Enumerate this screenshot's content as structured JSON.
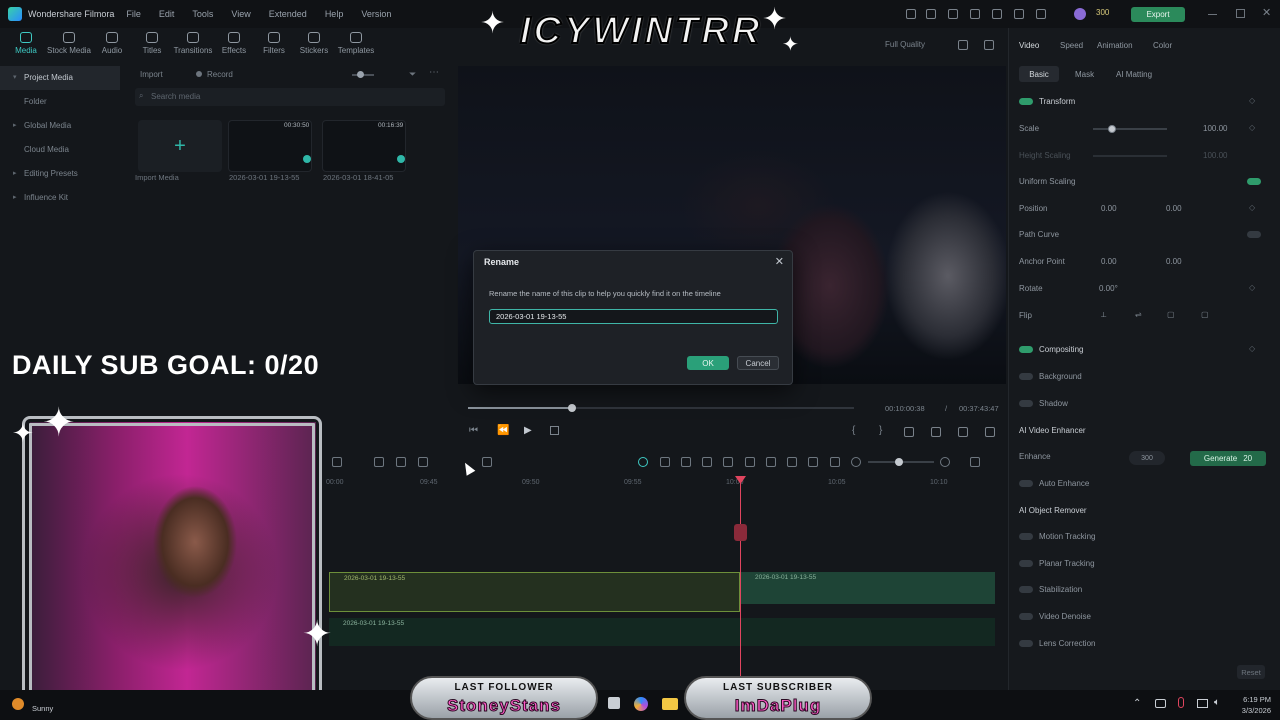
{
  "app": {
    "title": "Wondershare Filmora",
    "menu": [
      "File",
      "Edit",
      "Tools",
      "View",
      "Extended",
      "Help",
      "Version"
    ],
    "credits": "300",
    "export_label": "Export"
  },
  "media_tabs": [
    "Media",
    "Stock Media",
    "Audio",
    "Titles",
    "Transitions",
    "Effects",
    "Filters",
    "Stickers",
    "Templates"
  ],
  "sidebar": {
    "items": [
      "Project Media",
      "Folder",
      "Global Media",
      "Cloud Media",
      "Editing Presets",
      "Influence Kit"
    ]
  },
  "media": {
    "import_label": "Import",
    "record_label": "Record",
    "search_placeholder": "Search media",
    "import_media_label": "Import Media",
    "clips": [
      {
        "name": "2026-03-01 19-13-55",
        "duration": "00:30:50"
      },
      {
        "name": "2026-03-01 18-41-05",
        "duration": "00:16:39"
      }
    ]
  },
  "preview": {
    "quality": "Full Quality",
    "current_time": "00:10:00:38",
    "separator": "/",
    "total_time": "00:37:43:47"
  },
  "dialog": {
    "title": "Rename",
    "description": "Rename the name of this clip to help you quickly find it on the timeline",
    "value": "2026-03-01 19-13-55",
    "ok_label": "OK",
    "cancel_label": "Cancel"
  },
  "right_panel": {
    "tabs": [
      "Video",
      "Speed",
      "Animation",
      "Color"
    ],
    "subtabs": [
      "Basic",
      "Mask",
      "AI Matting"
    ],
    "transform": "Transform",
    "scale_label": "Scale",
    "scale_value": "100.00",
    "height_scaling_label": "Height Scaling",
    "height_scaling_value": "100.00",
    "uniform_scaling_label": "Uniform Scaling",
    "position_label": "Position",
    "position_x": "0.00",
    "position_y": "0.00",
    "path_curve_label": "Path Curve",
    "anchor_label": "Anchor Point",
    "anchor_x": "0.00",
    "anchor_y": "0.00",
    "rotate_label": "Rotate",
    "rotate_value": "0.00°",
    "flip_label": "Flip",
    "compositing": "Compositing",
    "background_label": "Background",
    "shadow_label": "Shadow",
    "ai_enhancer": "AI Video Enhancer",
    "enhance_label": "Enhance",
    "enhance_credits": "300",
    "generate_label": "Generate",
    "generate_credits": "20",
    "auto_enhance": "Auto Enhance",
    "ai_object_remover": "AI Object Remover",
    "motion_tracking": "Motion Tracking",
    "planar_tracking": "Planar Tracking",
    "stabilization": "Stabilization",
    "video_denoise": "Video Denoise",
    "lens_correction": "Lens Correction",
    "reset_label": "Reset"
  },
  "timeline": {
    "ruler": [
      "00:00",
      "09:45",
      "09:50",
      "09:55",
      "10:00",
      "10:05",
      "10:10"
    ],
    "clip_label": "2026-03-01 19-13-55"
  },
  "overlays": {
    "brand": "ICYWINTRR",
    "sub_goal": "DAILY SUB GOAL: 0/20",
    "last_follower_title": "LAST FOLLOWER",
    "last_follower_name": "StoneyStans",
    "last_subscriber_title": "LAST SUBSCRIBER",
    "last_subscriber_name": "ImDaPlug"
  },
  "taskbar": {
    "weather": "Sunny",
    "time": "6:19 PM",
    "date": "3/3/2026"
  }
}
